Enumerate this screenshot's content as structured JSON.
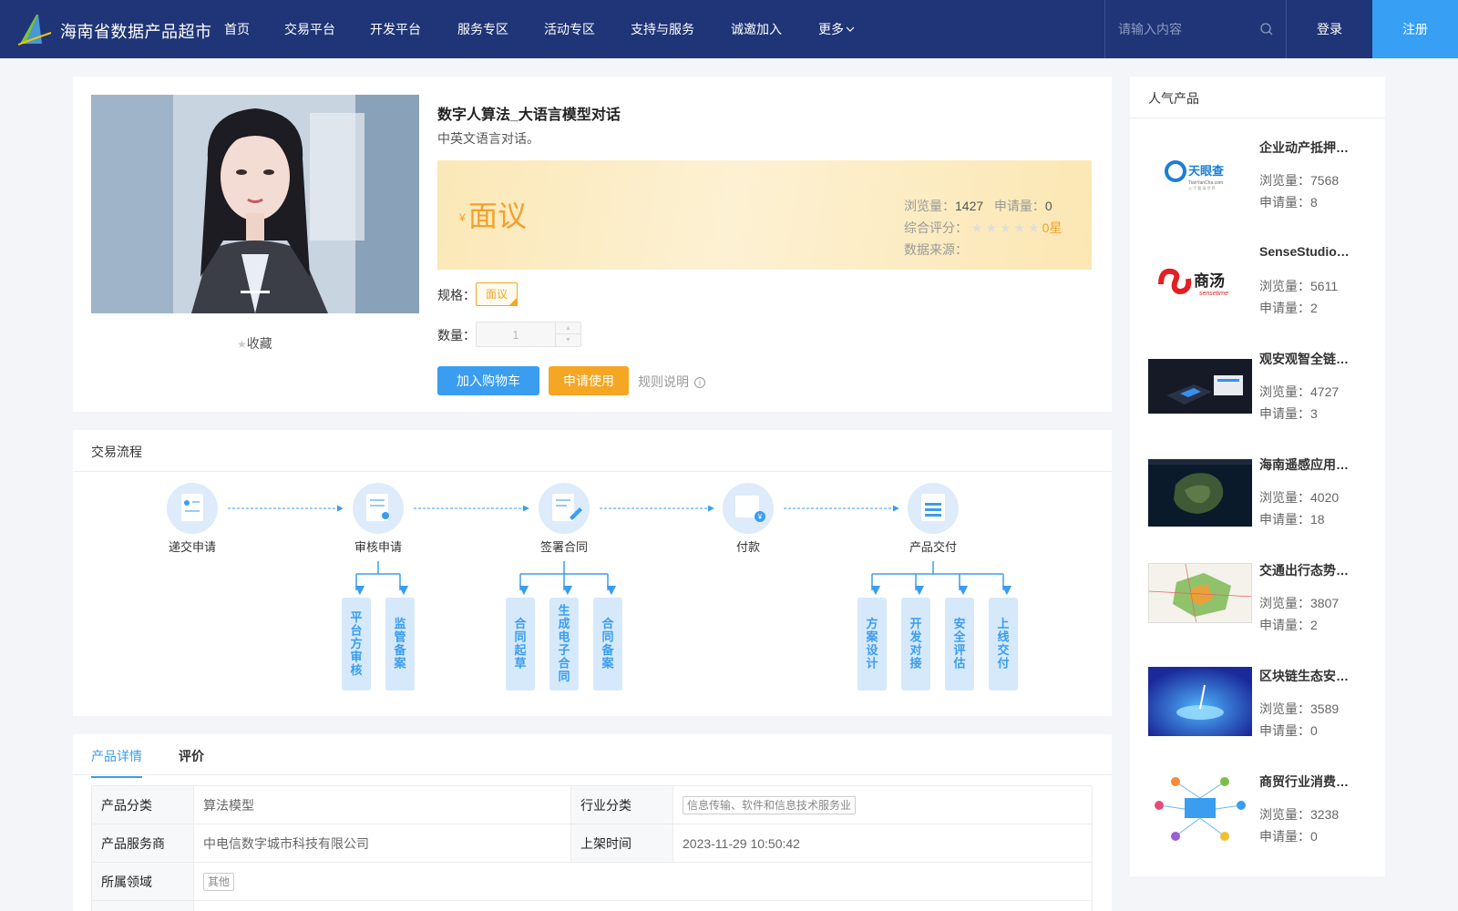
{
  "header": {
    "site_title": "海南省数据产品超市",
    "nav": [
      "首页",
      "交易平台",
      "开发平台",
      "服务专区",
      "活动专区",
      "支持与服务",
      "诚邀加入",
      "更多"
    ],
    "search_placeholder": "请输入内容",
    "login": "登录",
    "register": "注册"
  },
  "product": {
    "title": "数字人算法_大语言模型对话",
    "description": "中英文语言对话。",
    "favorite_label": "收藏",
    "price_symbol": "¥",
    "price": "面议",
    "views_label": "浏览量：",
    "views": "1427",
    "apply_label": "申请量：",
    "applies": "0",
    "rating_label": "综合评分：",
    "rating": "0星",
    "stars_filled": 0,
    "stars_total": 5,
    "source_label": "数据来源：",
    "spec_label": "规格：",
    "spec_value": "面议",
    "qty_label": "数量：",
    "qty_value": "1",
    "add_cart": "加入购物车",
    "apply_use": "申请使用",
    "rules": "规则说明"
  },
  "process": {
    "title": "交易流程",
    "steps": [
      "递交申请",
      "审核申请",
      "签署合同",
      "付款",
      "产品交付"
    ],
    "substeps": {
      "审核申请": [
        "平台方审核",
        "监管备案"
      ],
      "签署合同": [
        "合同起草",
        "生成电子合同",
        "合同备案"
      ],
      "产品交付": [
        "方案设计",
        "开发对接",
        "安全评估",
        "上线交付"
      ]
    }
  },
  "details": {
    "tabs": [
      "产品详情",
      "评价"
    ],
    "rows": [
      {
        "k1": "产品分类",
        "v1": "算法模型",
        "k2": "行业分类",
        "v2": "信息传输、软件和信息技术服务业"
      },
      {
        "k1": "产品服务商",
        "v1": "中电信数字城市科技有限公司",
        "k2": "上架时间",
        "v2": "2023-11-29 10:50:42"
      },
      {
        "k1": "所属领域",
        "v1": "其他"
      }
    ]
  },
  "popular": {
    "title": "人气产品",
    "views_label": "浏览量：",
    "apply_label": "申请量：",
    "items": [
      {
        "name": "企业动产抵押…",
        "views": "7568",
        "applies": "8",
        "thumb": "tianyancha"
      },
      {
        "name": "SenseStudio…",
        "views": "5611",
        "applies": "2",
        "thumb": "sensetime"
      },
      {
        "name": "观安观智全链…",
        "views": "4727",
        "applies": "3",
        "thumb": "dark-ui"
      },
      {
        "name": "海南遥感应用…",
        "views": "4020",
        "applies": "18",
        "thumb": "satellite"
      },
      {
        "name": "交通出行态势…",
        "views": "3807",
        "applies": "2",
        "thumb": "map"
      },
      {
        "name": "区块链生态安…",
        "views": "3589",
        "applies": "0",
        "thumb": "blockchain"
      },
      {
        "name": "商贸行业消费…",
        "views": "3238",
        "applies": "0",
        "thumb": "network"
      }
    ],
    "thumb_texts": {
      "tianyancha_cn": "天眼查",
      "tianyancha_en": "TianYanCha.com",
      "tianyancha_sub": "公 平 看 清 世 界",
      "sensetime_cn": "商汤",
      "sensetime_en": "sensetime"
    }
  },
  "colors": {
    "header_bg": "#1f3577",
    "accent_blue": "#3a9df0",
    "accent_orange": "#f5a623"
  }
}
